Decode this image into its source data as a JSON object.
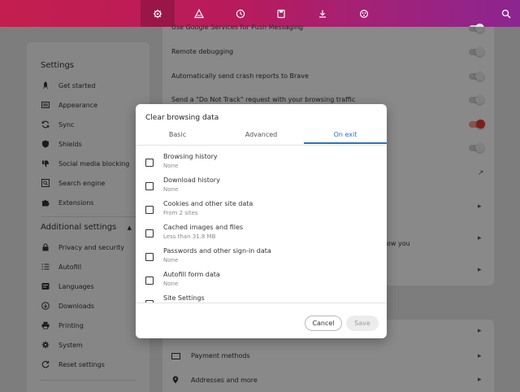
{
  "toolbar": {
    "icons": [
      "settings-icon",
      "shields-icon",
      "history-icon",
      "bookmarks-icon",
      "downloads-icon",
      "extensions-icon",
      "search-icon"
    ],
    "accent_gradient": [
      "#c41e4f",
      "#8c2590"
    ]
  },
  "sidebar": {
    "title": "Settings",
    "items": [
      {
        "label": "Get started",
        "icon": "rocket-icon"
      },
      {
        "label": "Appearance",
        "icon": "appearance-icon"
      },
      {
        "label": "Sync",
        "icon": "sync-icon"
      },
      {
        "label": "Shields",
        "icon": "shield-icon"
      },
      {
        "label": "Social media blocking",
        "icon": "thumbs-down-icon"
      },
      {
        "label": "Search engine",
        "icon": "search-engine-icon"
      },
      {
        "label": "Extensions",
        "icon": "puzzle-icon"
      }
    ],
    "advanced_title": "Additional settings",
    "advanced_items": [
      {
        "label": "Privacy and security",
        "icon": "lock-icon"
      },
      {
        "label": "Autofill",
        "icon": "autofill-icon"
      },
      {
        "label": "Languages",
        "icon": "languages-icon"
      },
      {
        "label": "Downloads",
        "icon": "download-icon"
      },
      {
        "label": "Printing",
        "icon": "printer-icon"
      },
      {
        "label": "System",
        "icon": "system-icon"
      },
      {
        "label": "Reset settings",
        "icon": "reset-icon"
      }
    ]
  },
  "main": {
    "rows": [
      {
        "label": "Use Google Services for Push Messaging",
        "control": "toggle",
        "on": false
      },
      {
        "label": "Remote debugging",
        "control": "toggle",
        "on": false
      },
      {
        "label": "Automatically send crash reports to Brave",
        "control": "toggle",
        "on": false
      },
      {
        "label": "Send a \"Do Not Track\" request with your browsing traffic",
        "control": "toggle",
        "on": false
      }
    ],
    "partial_text": "ow you",
    "lower_rows": [
      {
        "label": "Payment methods",
        "icon": "card-icon"
      },
      {
        "label": "Addresses and more",
        "icon": "location-icon"
      }
    ]
  },
  "dialog": {
    "title": "Clear browsing data",
    "tabs": [
      "Basic",
      "Advanced",
      "On exit"
    ],
    "active_tab": "On exit",
    "items": [
      {
        "title": "Browsing history",
        "sub": "None",
        "checked": false
      },
      {
        "title": "Download history",
        "sub": "None",
        "checked": false
      },
      {
        "title": "Cookies and other site data",
        "sub": "From 2 sites",
        "checked": false
      },
      {
        "title": "Cached images and files",
        "sub": "Less than 31.8 MB",
        "checked": false
      },
      {
        "title": "Passwords and other sign-in data",
        "sub": "None",
        "checked": false
      },
      {
        "title": "Autofill form data",
        "sub": "None",
        "checked": false
      },
      {
        "title": "Site Settings",
        "sub": "",
        "checked": false
      }
    ],
    "cancel_label": "Cancel",
    "save_label": "Save",
    "accent": "#2a6fc9"
  }
}
